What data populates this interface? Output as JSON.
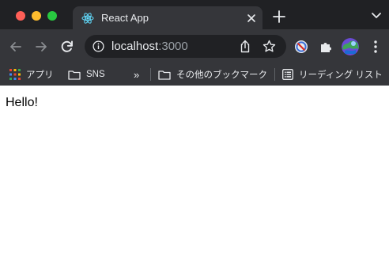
{
  "tab": {
    "title": "React App",
    "favicon": "react-icon"
  },
  "address_bar": {
    "host": "localhost",
    "port": ":3000"
  },
  "bookmarks": {
    "apps": "アプリ",
    "sns": "SNS",
    "more": "»",
    "other": "その他のブックマーク",
    "reading_list": "リーディング リスト"
  },
  "page": {
    "text": "Hello!"
  },
  "colors": {
    "tabstrip": "#202124",
    "toolbar": "#35363a",
    "omnibox": "#202124",
    "react": "#61dafb"
  }
}
